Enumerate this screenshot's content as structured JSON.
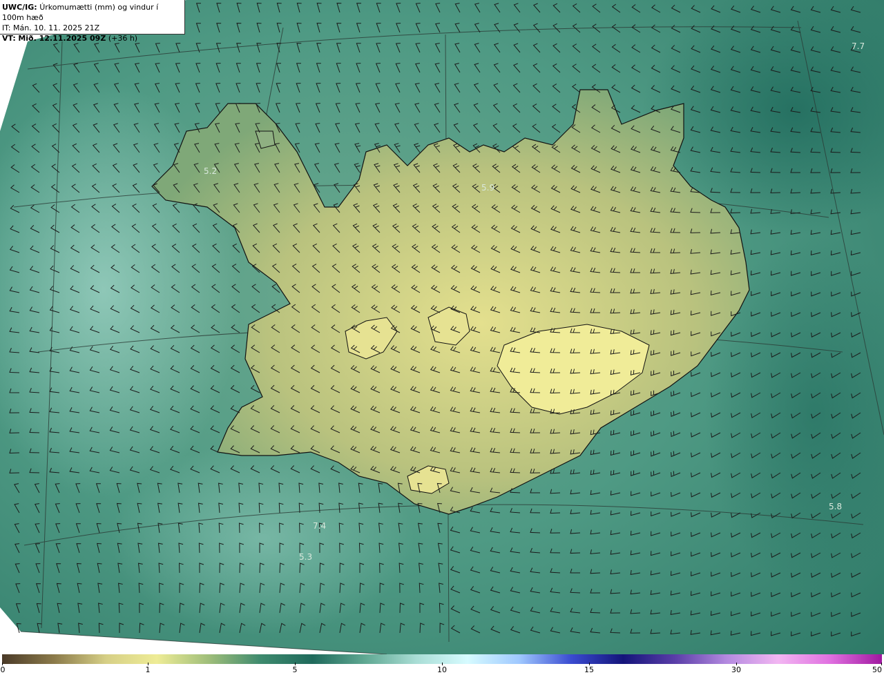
{
  "header": {
    "model_label": "UWC/IG:",
    "title": "Úrkomumætti (mm) og vindur í 100m hæð",
    "it_label": "IT:",
    "it_value": "Mán. 10. 11. 2025 21Z",
    "vt_label": "VT:",
    "vt_value": "Mið. 12.11.2025 09Z",
    "lead": "(+36 h)"
  },
  "map_values": [
    "7.7",
    "5.2",
    "5.9",
    "5.8",
    "7.4",
    "5.3"
  ],
  "colorbar": {
    "ticks": [
      "0",
      "1",
      "5",
      "10",
      "15",
      "30",
      "50"
    ],
    "colors": [
      "#4a3a28",
      "#8b7a4a",
      "#d6cf86",
      "#eeec96",
      "#9fbe7a",
      "#3e8a6e",
      "#1f6a5c",
      "#5fa892",
      "#a9ddd5",
      "#d6fbff",
      "#9fc8ff",
      "#3a4bd0",
      "#14147a",
      "#5a3ea8",
      "#b48ae0",
      "#f2b6f2",
      "#e070e0",
      "#a018a0"
    ]
  }
}
